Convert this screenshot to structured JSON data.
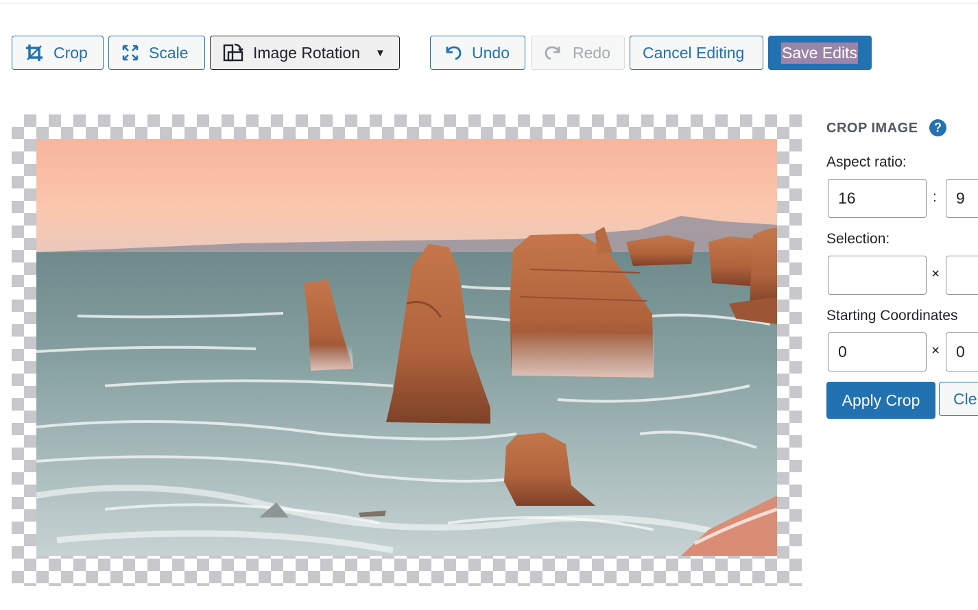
{
  "toolbar": {
    "crop": "Crop",
    "scale": "Scale",
    "rotation": "Image Rotation",
    "undo": "Undo",
    "redo": "Redo",
    "cancel": "Cancel Editing",
    "save": "Save Edits"
  },
  "panel": {
    "title": "CROP IMAGE",
    "help": "?",
    "aspect_label": "Aspect ratio:",
    "aspect_w": "16",
    "aspect_sep": ":",
    "aspect_h": "9",
    "selection_label": "Selection:",
    "selection_w": "",
    "selection_sep": "×",
    "selection_h": "",
    "coords_label": "Starting Coordinates",
    "coords_x": "0",
    "coords_sep": "×",
    "coords_y": "0",
    "apply": "Apply Crop",
    "clear": "Cle"
  },
  "icons": {
    "crop": "crop-icon",
    "scale": "scale-icon",
    "rotation": "rotation-icon",
    "undo": "undo-icon",
    "redo": "redo-icon",
    "help": "help-icon",
    "caret": "caret-down-icon"
  },
  "colors": {
    "accent": "#2271b1",
    "disabled": "#a7aaad",
    "highlight": "#9a85a8"
  }
}
